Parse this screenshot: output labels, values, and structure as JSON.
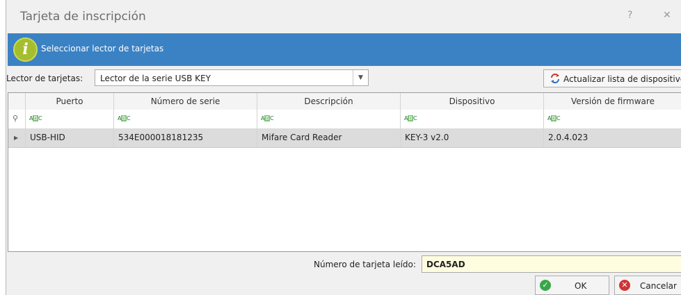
{
  "window": {
    "title": "Tarjeta de inscripción",
    "help_glyph": "?",
    "close_glyph": "✕"
  },
  "banner": {
    "icon": "info-icon",
    "text": "Seleccionar lector de tarjetas",
    "color": "#3b82c4"
  },
  "reader": {
    "label": "Lector de tarjetas:",
    "selected": "Lector de la serie USB KEY"
  },
  "refresh_button": {
    "label": "Actualizar lista de dispositivos",
    "icon": "refresh-icon"
  },
  "grid": {
    "columns": [
      "Puerto",
      "Número de serie",
      "Descripción",
      "Dispositivo",
      "Versión de firmware"
    ],
    "filter_icon": "abc-filter-icon",
    "rows": [
      {
        "port": "USB-HID",
        "serial": "534E000018181235",
        "description": "Mifare Card Reader",
        "device": "KEY-3 v2.0",
        "firmware": "2.0.4.023"
      }
    ]
  },
  "card": {
    "label": "Número de tarjeta leído:",
    "value": "DCA5AD"
  },
  "buttons": {
    "ok": "OK",
    "cancel": "Cancelar"
  }
}
